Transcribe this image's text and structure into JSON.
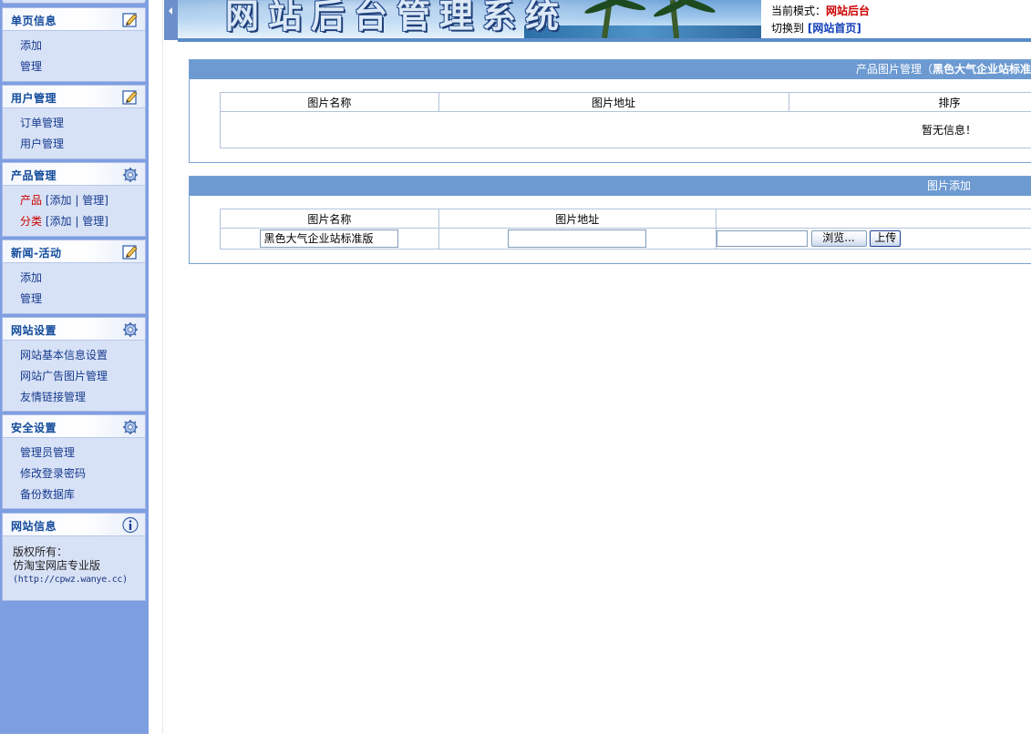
{
  "header": {
    "banner_title": "网站后台管理系统",
    "mode_label": "当前模式：",
    "mode_value": "网站后台",
    "switch_label": "切换到",
    "switch_link": "[网站首页]"
  },
  "sidebar": {
    "panels": [
      {
        "title": "单页信息",
        "icon": "edit-icon",
        "links": [
          "添加",
          "管理"
        ]
      },
      {
        "title": "用户管理",
        "icon": "edit-icon",
        "links": [
          "订单管理",
          "用户管理"
        ]
      },
      {
        "title": "产品管理",
        "icon": "settings-icon",
        "rows": [
          {
            "label": "产品",
            "add": "添加",
            "manage": "管理"
          },
          {
            "label": "分类",
            "add": "添加",
            "manage": "管理"
          }
        ]
      },
      {
        "title": "新闻-活动",
        "icon": "edit-icon",
        "links": [
          "添加",
          "管理"
        ]
      },
      {
        "title": "网站设置",
        "icon": "settings-icon",
        "links": [
          "网站基本信息设置",
          "网站广告图片管理",
          "友情链接管理"
        ]
      },
      {
        "title": "安全设置",
        "icon": "settings-icon",
        "links": [
          "管理员管理",
          "修改登录密码",
          "备份数据库"
        ]
      },
      {
        "title": "网站信息",
        "icon": "info-icon",
        "info": {
          "line1": "版权所有：",
          "line2": "仿淘宝网店专业版",
          "line3": "(http://cpwz.wanye.cc)"
        }
      }
    ]
  },
  "manage": {
    "title_prefix": "产品图片管理（",
    "title_bold": "黑色大气企业站标准",
    "columns": [
      "图片名称",
      "图片地址",
      "排序"
    ],
    "empty_text": "暂无信息！"
  },
  "add": {
    "title": "图片添加",
    "columns": [
      "图片名称",
      "图片地址",
      ""
    ],
    "name_value": "黑色大气企业站标准版",
    "url_value": "",
    "file_value": "",
    "browse_label": "浏览...",
    "upload_label": "上传"
  },
  "colors": {
    "sidebar_bg": "#7e9ee2",
    "panel_bg": "#d8e2f6",
    "header_bar": "#6c9ad1",
    "accent_red": "#cc0000",
    "link_blue": "#163a8e"
  }
}
